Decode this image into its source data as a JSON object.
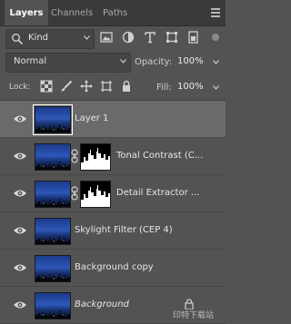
{
  "tabs": [
    {
      "label": "Layers",
      "active": true
    },
    {
      "label": "Channels",
      "active": false
    },
    {
      "label": "Paths",
      "active": false
    }
  ],
  "filter": {
    "label": "Kind"
  },
  "blend_mode": {
    "value": "Normal"
  },
  "opacity": {
    "label": "Opacity:",
    "value": "100%"
  },
  "lock": {
    "label": "Lock:"
  },
  "fill": {
    "label": "Fill:",
    "value": "100%"
  },
  "layers": [
    {
      "name": "Layer 1",
      "selected": true,
      "visible": true,
      "has_mask": false,
      "italic": false,
      "locked": false
    },
    {
      "name": "Tonal Contrast (C...",
      "selected": false,
      "visible": true,
      "has_mask": true,
      "italic": false,
      "locked": false
    },
    {
      "name": "Detail Extractor ...",
      "selected": false,
      "visible": true,
      "has_mask": true,
      "italic": false,
      "locked": false
    },
    {
      "name": "Skylight Filter (CEP 4)",
      "selected": false,
      "visible": true,
      "has_mask": false,
      "italic": false,
      "locked": false
    },
    {
      "name": "Background copy",
      "selected": false,
      "visible": true,
      "has_mask": false,
      "italic": false,
      "locked": false
    },
    {
      "name": "Background",
      "selected": false,
      "visible": true,
      "has_mask": false,
      "italic": true,
      "locked": true
    }
  ],
  "watermark": {
    "text": "印特下载站"
  },
  "colors": {
    "panel_bg": "#535353",
    "selected_row": "#6a6a6a",
    "tab_bar": "#3a3a3a"
  }
}
